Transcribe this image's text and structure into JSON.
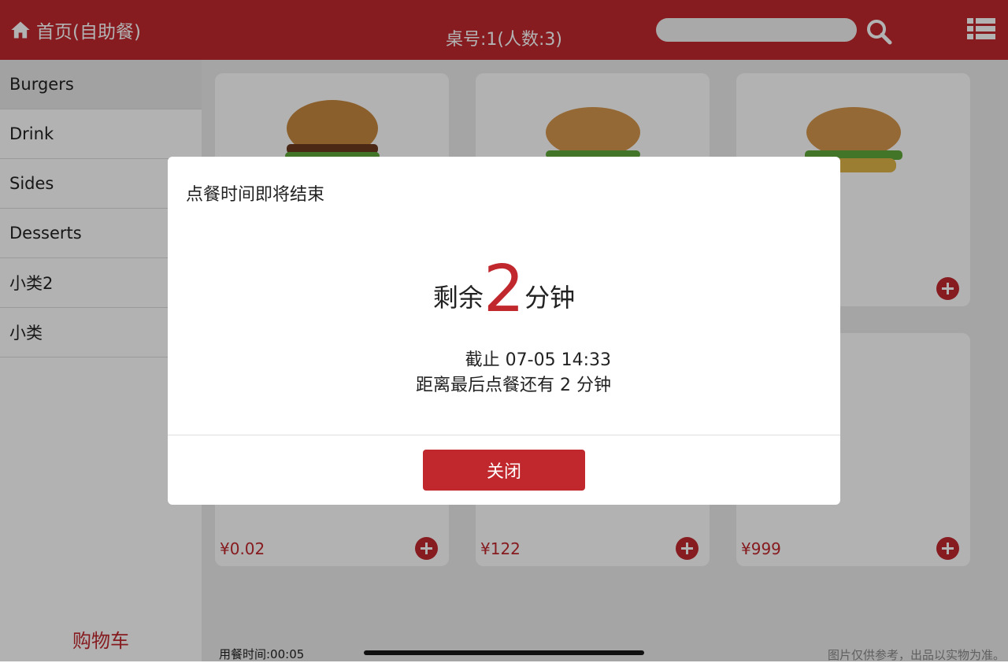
{
  "header": {
    "home_label": "首页(自助餐)",
    "table_info": "桌号:1(人数:3)",
    "search_placeholder": ""
  },
  "sidebar": {
    "items": [
      {
        "label": "Burgers",
        "active": true
      },
      {
        "label": "Drink"
      },
      {
        "label": "Sides"
      },
      {
        "label": "Desserts"
      },
      {
        "label": "小类2"
      },
      {
        "label": "小类"
      }
    ],
    "cart_label": "购物车"
  },
  "products": [
    {
      "price": "",
      "image": "burger-icon"
    },
    {
      "price": "",
      "image": "burger-icon"
    },
    {
      "price": "",
      "image": "burger-icon"
    },
    {
      "price": "¥0.02"
    },
    {
      "price": "¥122"
    },
    {
      "price": "¥999"
    }
  ],
  "footer": {
    "dining_time": "用餐时间:00:05",
    "note": "图片仅供参考，出品以实物为准。"
  },
  "modal": {
    "title": "点餐时间即将结束",
    "remaining_prefix": "剩余",
    "remaining_minutes": "2",
    "remaining_suffix": "分钟",
    "deadline_line": "截止 07-05 14:33",
    "countdown_line": "距离最后点餐还有 2 分钟",
    "close_label": "关闭"
  },
  "colors": {
    "brand": "#c0282e",
    "overlay": "rgba(0,0,0,0.30)"
  }
}
